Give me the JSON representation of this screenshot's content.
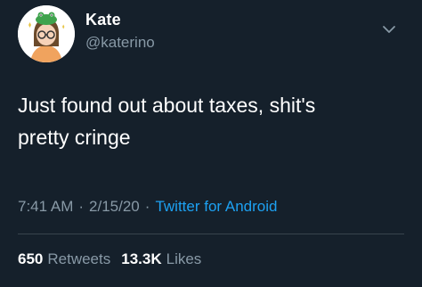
{
  "tweet": {
    "author": {
      "name": "Kate",
      "handle": "@katerino",
      "avatar_icon": "avatar-illustration"
    },
    "text": "Just found out about taxes, shit's\npretty cringe",
    "time": "7:41 AM",
    "date": "2/15/20",
    "separator": "·",
    "source": "Twitter for Android",
    "stats": {
      "retweets_count": "650",
      "retweets_label": "Retweets",
      "likes_count": "13.3K",
      "likes_label": "Likes"
    },
    "menu_icon": "chevron-down-icon"
  },
  "colors": {
    "background": "#15202b",
    "text": "#ffffff",
    "secondary_text": "#8899a6",
    "link": "#1da1f2",
    "divider": "#38444d"
  }
}
